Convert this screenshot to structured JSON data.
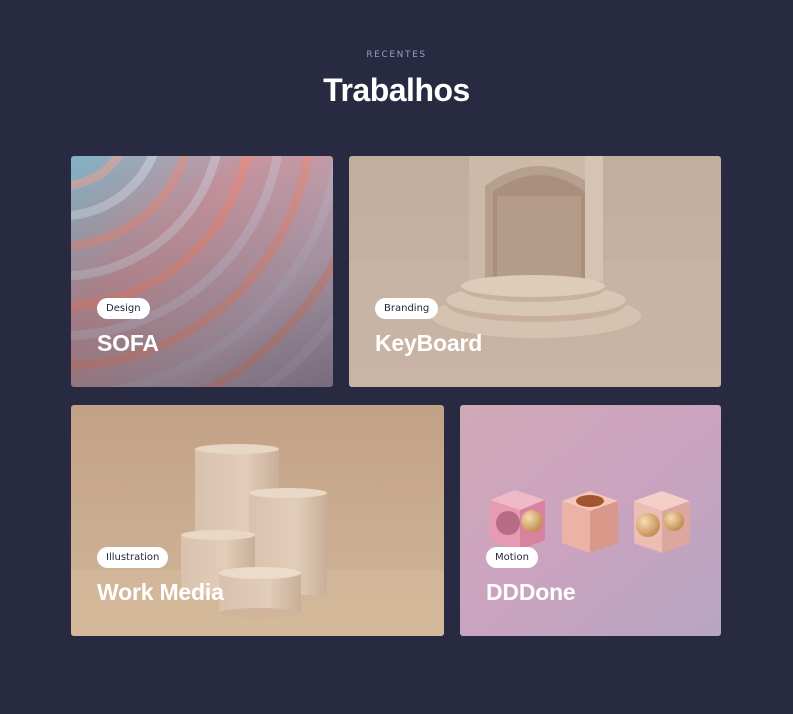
{
  "section": {
    "eyebrow": "RECENTES",
    "title": "Trabalhos"
  },
  "projects": [
    {
      "tag": "Design",
      "title": "SOFA",
      "art": "pink-blue-ripple-waves"
    },
    {
      "tag": "Branding",
      "title": "KeyBoard",
      "art": "beige-archway-podium"
    },
    {
      "tag": "Illustration",
      "title": "Work Media",
      "art": "beige-cylinder-pedestals"
    },
    {
      "tag": "Motion",
      "title": "DDDone",
      "art": "pink-hollow-cubes-with-golden-spheres"
    }
  ],
  "colors": {
    "background": "#282a41",
    "eyebrow": "#9c9dc2",
    "tag_bg": "#ffffff",
    "tag_text": "#24263d"
  }
}
